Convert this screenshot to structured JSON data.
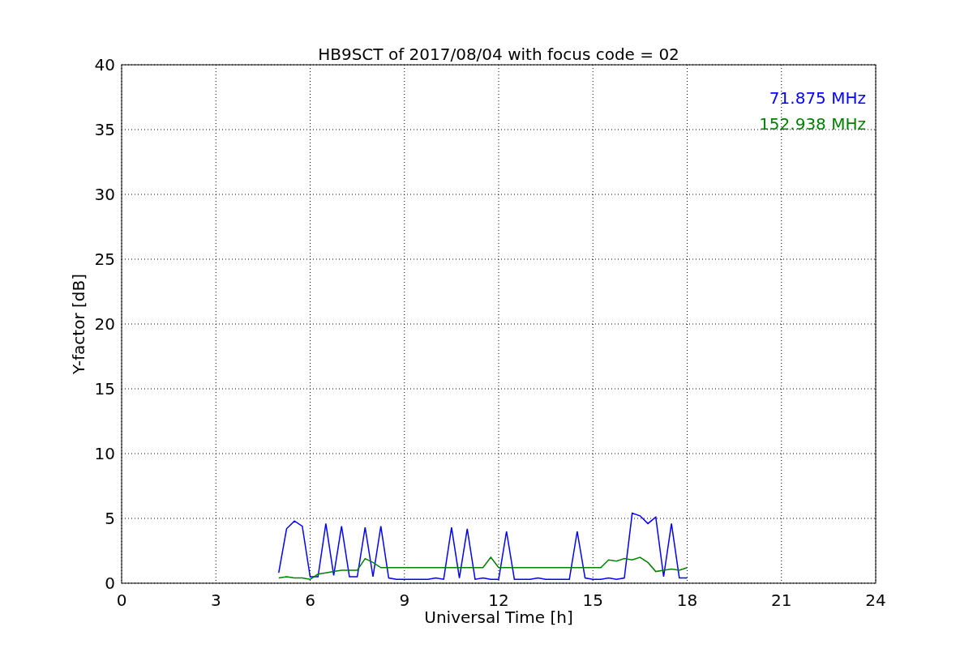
{
  "chart_data": {
    "type": "line",
    "title": "HB9SCT of 2017/08/04 with focus code = 02",
    "xlabel": "Universal Time [h]",
    "ylabel": "Y-factor [dB]",
    "x": [
      5,
      5.25,
      5.5,
      5.75,
      6,
      6.25,
      6.5,
      6.75,
      7,
      7.25,
      7.5,
      7.75,
      8,
      8.25,
      8.5,
      8.75,
      9,
      9.25,
      9.5,
      9.75,
      10,
      10.25,
      10.5,
      10.75,
      11,
      11.25,
      11.5,
      11.75,
      12,
      12.25,
      12.5,
      12.75,
      13,
      13.25,
      13.5,
      13.75,
      14,
      14.25,
      14.5,
      14.75,
      15,
      15.25,
      15.5,
      15.75,
      16,
      16.25,
      16.5,
      16.75,
      17,
      17.25,
      17.5,
      17.75,
      18
    ],
    "series": [
      {
        "name": "71.875 MHz",
        "color": "#0000ff",
        "values": [
          0.8,
          4.2,
          4.8,
          4.4,
          0.5,
          0.5,
          4.6,
          0.6,
          4.4,
          0.5,
          0.5,
          4.3,
          0.5,
          4.4,
          0.4,
          0.3,
          0.3,
          0.3,
          0.3,
          0.3,
          0.4,
          0.3,
          4.3,
          0.4,
          4.2,
          0.3,
          0.4,
          0.3,
          0.3,
          4.0,
          0.3,
          0.3,
          0.3,
          0.4,
          0.3,
          0.3,
          0.3,
          0.3,
          4.0,
          0.4,
          0.3,
          0.3,
          0.4,
          0.3,
          0.4,
          5.4,
          5.2,
          4.6,
          5.1,
          0.5,
          4.6,
          0.4,
          0.4
        ]
      },
      {
        "name": "152.938 MHz",
        "color": "#008000",
        "values": [
          0.4,
          0.5,
          0.4,
          0.4,
          0.3,
          0.7,
          0.8,
          0.9,
          1.0,
          1.0,
          1.0,
          1.9,
          1.6,
          1.2,
          1.2,
          1.2,
          1.2,
          1.2,
          1.2,
          1.2,
          1.2,
          1.2,
          1.2,
          1.2,
          1.2,
          1.2,
          1.2,
          2.0,
          1.2,
          1.2,
          1.2,
          1.2,
          1.2,
          1.2,
          1.2,
          1.2,
          1.2,
          1.2,
          1.2,
          1.2,
          1.2,
          1.2,
          1.8,
          1.7,
          1.9,
          1.8,
          2.0,
          1.6,
          0.9,
          1.0,
          1.1,
          1.0,
          1.2
        ]
      }
    ],
    "xlim": [
      0,
      24
    ],
    "ylim": [
      0,
      40
    ],
    "xticks": [
      0,
      3,
      6,
      9,
      12,
      15,
      18,
      21,
      24
    ],
    "yticks": [
      0,
      5,
      10,
      15,
      20,
      25,
      30,
      35,
      40
    ],
    "grid": true
  }
}
